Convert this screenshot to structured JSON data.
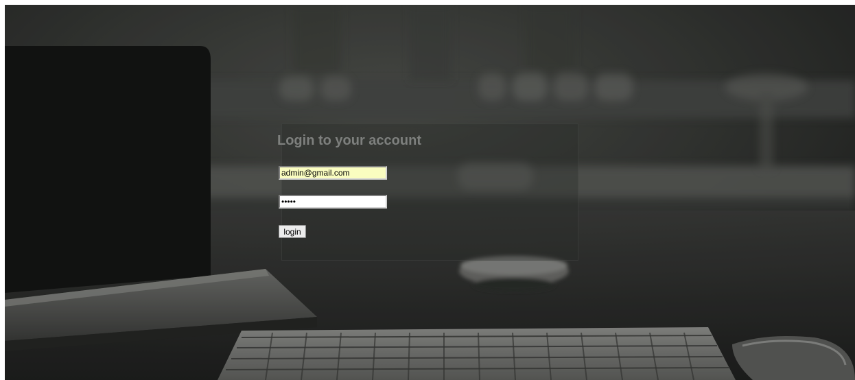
{
  "login": {
    "title": "Login to your account",
    "email_value": "admin@gmail.com",
    "password_value": "•••••",
    "button_label": "login"
  },
  "colors": {
    "email_autofill_bg": "#fafdc0",
    "title_text": "#7e807e",
    "background_dark": "#2b2c2a"
  },
  "background": {
    "icons": [
      "laptop-icon",
      "keyboard-icon",
      "mouse-icon",
      "bowl-icon",
      "glass-icon",
      "bottles-icon"
    ]
  }
}
